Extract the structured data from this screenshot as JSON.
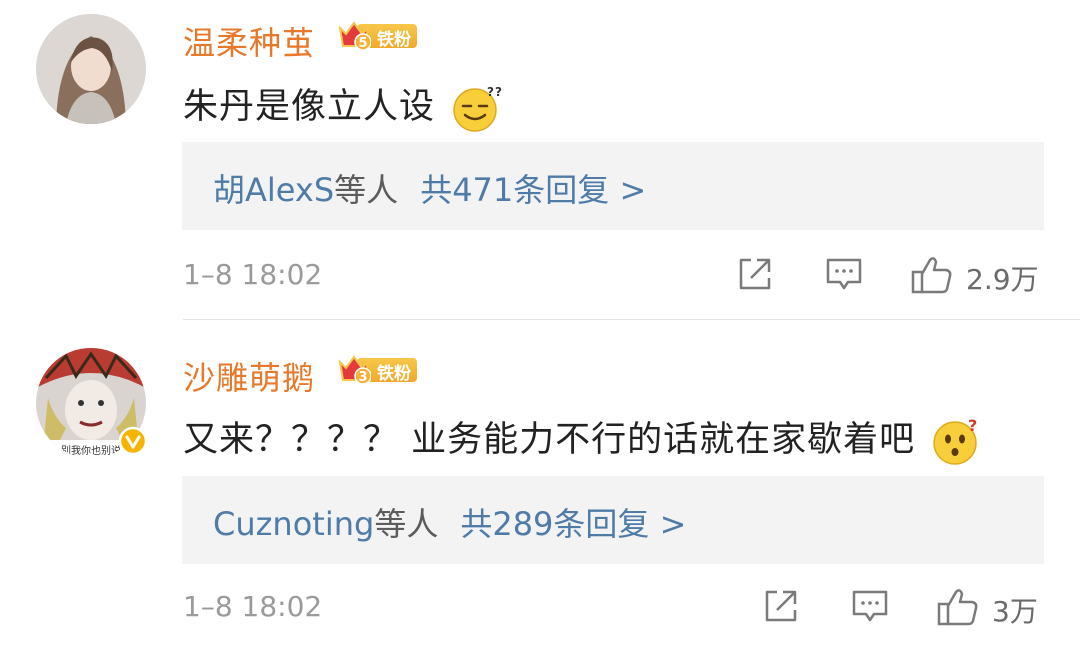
{
  "comments": [
    {
      "username": "温柔种茧",
      "badge_level": "5",
      "badge_text": "铁粉",
      "text": "朱丹是像立人设",
      "emoji": "sweat-smile-emoji",
      "reply_names": "胡AlexS",
      "reply_suffix": "等人",
      "reply_count": "共471条回复 >",
      "timestamp": "1–8 18:02",
      "likes": "2.9万"
    },
    {
      "username": "沙雕萌鹅",
      "badge_level": "3",
      "badge_text": "铁粉",
      "text": "又来？？？？ 业务能力不行的话就在家歇着吧",
      "emoji": "confused-emoji",
      "avatar_caption": "别我你也别说",
      "reply_names": "Cuznoting",
      "reply_suffix": "等人",
      "reply_count": "共289条回复 >",
      "timestamp": "1–8 18:02",
      "likes": "3万"
    }
  ],
  "colors": {
    "username": "#e8782a",
    "link": "#4f7ba8",
    "badge": "#f0a92a",
    "meta": "#9a9a9a"
  }
}
